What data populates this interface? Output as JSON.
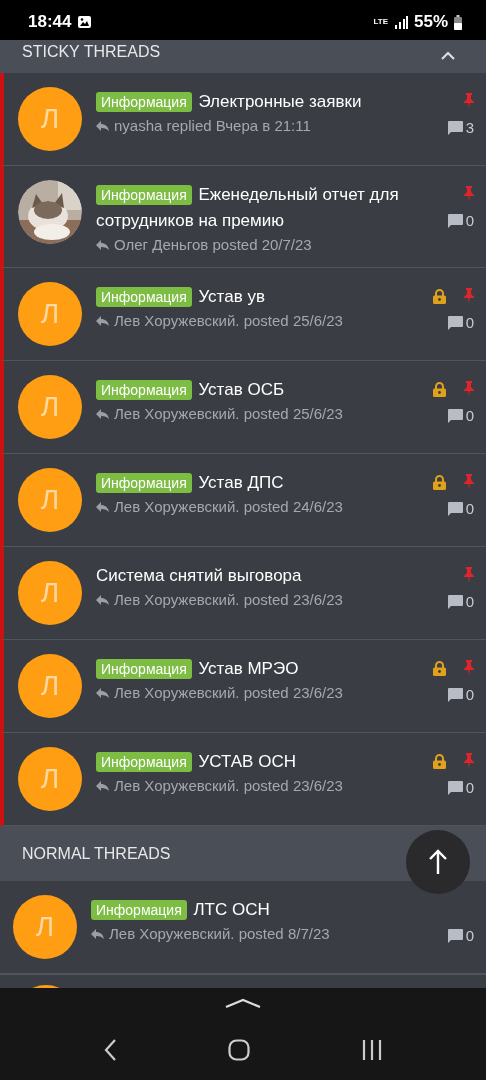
{
  "status_bar": {
    "time": "18:44",
    "lte": "LTE",
    "battery": "55%"
  },
  "sections": [
    {
      "title": "STICKY THREADS",
      "kind": "sticky",
      "collapse_icon": true,
      "threads": [
        {
          "prefix": "Информация",
          "title": "Электронные заявки",
          "meta": "nyasha replied Вчера в 21:11",
          "avatar": {
            "kind": "letter",
            "letter": "Л"
          },
          "locked": false,
          "pinned": true,
          "replies": "3"
        },
        {
          "prefix": "Информация",
          "title": "Еженедельный отчет для сотрудников на премию",
          "meta": "Олег Деньгов posted 20/7/23",
          "locked": false,
          "pinned": true,
          "replies": "0"
        },
        {
          "prefix": "Информация",
          "title": "Устав ув",
          "meta": "Лев Хоружевский. posted 25/6/23",
          "avatar": {
            "kind": "letter",
            "letter": "Л"
          },
          "locked": true,
          "pinned": true,
          "replies": "0"
        },
        {
          "prefix": "Информация",
          "title": "Устав ОСБ",
          "meta": "Лев Хоружевский. posted 25/6/23",
          "avatar": {
            "kind": "letter",
            "letter": "Л"
          },
          "locked": true,
          "pinned": true,
          "replies": "0"
        },
        {
          "prefix": "Информация",
          "title": "Устав ДПС",
          "meta": "Лев Хоружевский. posted 24/6/23",
          "avatar": {
            "kind": "letter",
            "letter": "Л"
          },
          "locked": true,
          "pinned": true,
          "replies": "0"
        },
        {
          "title": "Система снятий выговора",
          "meta": "Лев Хоружевский. posted 23/6/23",
          "avatar": {
            "kind": "letter",
            "letter": "Л"
          },
          "locked": false,
          "pinned": true,
          "replies": "0"
        },
        {
          "prefix": "Информация",
          "title": "Устав МРЭО",
          "meta": "Лев Хоружевский. posted 23/6/23",
          "avatar": {
            "kind": "letter",
            "letter": "Л"
          },
          "locked": true,
          "pinned": true,
          "replies": "0"
        },
        {
          "prefix": "Информация",
          "title": "УСТАВ ОСН",
          "meta": "Лев Хоружевский. posted 23/6/23",
          "avatar": {
            "kind": "letter",
            "letter": "Л"
          },
          "locked": true,
          "pinned": true,
          "replies": "0"
        }
      ]
    },
    {
      "title": "NORMAL THREADS",
      "kind": "normal",
      "collapse_icon": false,
      "threads": [
        {
          "prefix": "Информация",
          "title": "ЛТС ОСН",
          "meta": "Лев Хоружевский. posted 8/7/23",
          "avatar": {
            "kind": "letter",
            "letter": "Л"
          },
          "locked": false,
          "pinned": false,
          "replies": "0"
        }
      ]
    }
  ]
}
